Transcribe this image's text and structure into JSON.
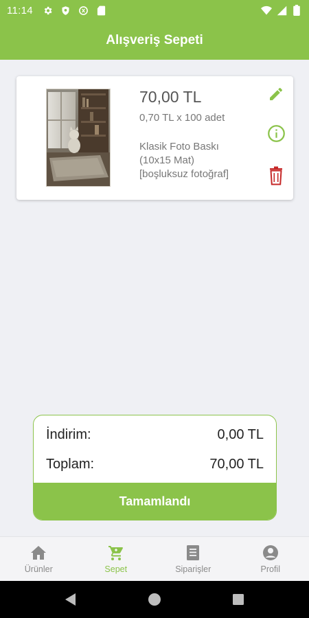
{
  "status_bar": {
    "time": "11:14",
    "left_icons": [
      "gear-icon",
      "shield-icon",
      "data-saver-icon",
      "sd-card-icon"
    ],
    "right_icons": [
      "wifi-icon",
      "signal-icon",
      "battery-icon"
    ]
  },
  "app_bar": {
    "title": "Alışveriş Sepeti"
  },
  "cart_item": {
    "price": "70,00 TL",
    "unit_line": "0,70 TL x 100 adet",
    "description_lines": [
      "Klasik Foto Baskı",
      "(10x15 Mat)",
      "[boşluksuz fotoğraf]"
    ],
    "actions": [
      "edit-icon",
      "info-icon",
      "delete-icon"
    ]
  },
  "summary": {
    "discount_label": "İndirim:",
    "discount_value": "0,00 TL",
    "total_label": "Toplam:",
    "total_value": "70,00 TL",
    "complete_button": "Tamamlandı"
  },
  "bottom_nav": {
    "items": [
      {
        "label": "Ürünler",
        "icon": "home-icon",
        "active": false
      },
      {
        "label": "Sepet",
        "icon": "cart-icon",
        "active": true
      },
      {
        "label": "Siparişler",
        "icon": "orders-icon",
        "active": false
      },
      {
        "label": "Profil",
        "icon": "profile-icon",
        "active": false
      }
    ]
  },
  "colors": {
    "accent": "#8bc34a",
    "delete": "#c62828",
    "background": "#eff0f4"
  }
}
